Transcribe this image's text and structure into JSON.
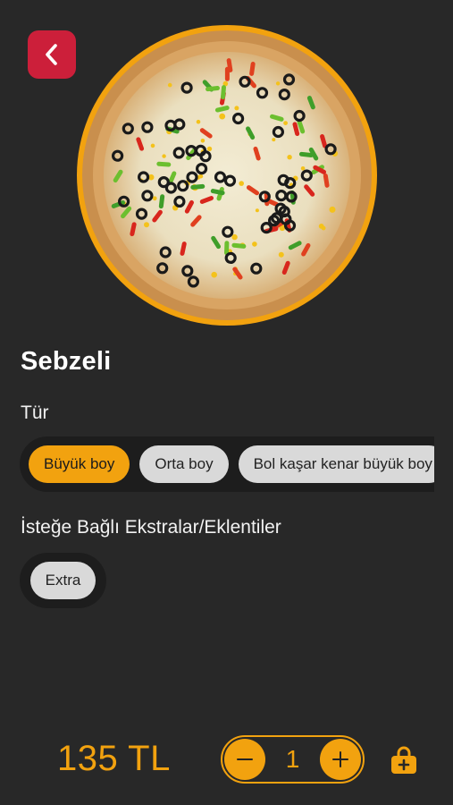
{
  "product": {
    "name": "Sebzeli",
    "price": "135 TL",
    "image_icon": "pizza-image"
  },
  "type_section": {
    "label": "Tür",
    "options": [
      {
        "label": "Büyük boy",
        "selected": true
      },
      {
        "label": "Orta boy",
        "selected": false
      },
      {
        "label": "Bol kaşar kenar büyük boy",
        "selected": false
      }
    ]
  },
  "extras_section": {
    "label": "İsteğe Bağlı Ekstralar/Eklentiler",
    "options": [
      {
        "label": "Extra"
      }
    ]
  },
  "cart": {
    "quantity": "1",
    "decrease_icon": "minus-icon",
    "increase_icon": "plus-icon",
    "add_icon": "bag-plus-icon"
  },
  "navigation": {
    "back_icon": "chevron-left-icon"
  },
  "colors": {
    "accent": "#f2a20f",
    "back_button": "#cc1f3a",
    "background": "#282828",
    "chip_track": "#1d1d1d",
    "chip_inactive": "#d9d9d9"
  }
}
